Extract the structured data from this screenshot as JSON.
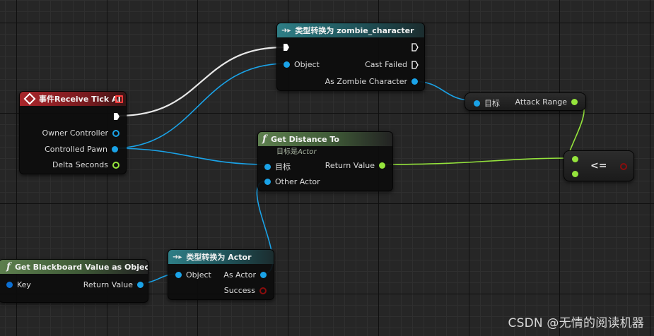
{
  "watermark": "CSDN @无情的阅读机器",
  "nodes": {
    "cast_zombie": {
      "title": "类型转换为 zombie_character",
      "icon": "cast-arrow-icon",
      "pins": {
        "object": "Object",
        "cast_failed": "Cast Failed",
        "as_output": "As Zombie Character"
      }
    },
    "event_tick": {
      "title": "事件Receive Tick AI",
      "icon": "event-diamond-icon",
      "pins": {
        "owner_controller": "Owner Controller",
        "controlled_pawn": "Controlled Pawn",
        "delta_seconds": "Delta Seconds"
      }
    },
    "attack_range": {
      "target": "目标",
      "output": "Attack Range"
    },
    "get_distance": {
      "title": "Get Distance To",
      "subtitle_prefix": "目标是",
      "subtitle_class": "Actor",
      "icon": "function-icon",
      "pins": {
        "target": "目标",
        "other_actor": "Other Actor",
        "return_value": "Return Value"
      }
    },
    "compare": {
      "operator": "<="
    },
    "get_blackboard": {
      "title": "Get Blackboard Value as Object",
      "icon": "function-icon",
      "pins": {
        "key": "Key",
        "return_value": "Return Value"
      }
    },
    "cast_actor": {
      "title": "类型转换为 Actor",
      "icon": "cast-arrow-icon",
      "pins": {
        "object": "Object",
        "as_output": "As Actor",
        "success": "Success"
      }
    }
  },
  "colors": {
    "object_pin": "#1aa3e8",
    "float_pin": "#95e43c",
    "bool_pin": "#8a0d0d",
    "exec_wire": "#ffffff",
    "cast_header": "#2e7e86",
    "event_header": "#a8262b",
    "function_header": "#5d7f4e"
  }
}
